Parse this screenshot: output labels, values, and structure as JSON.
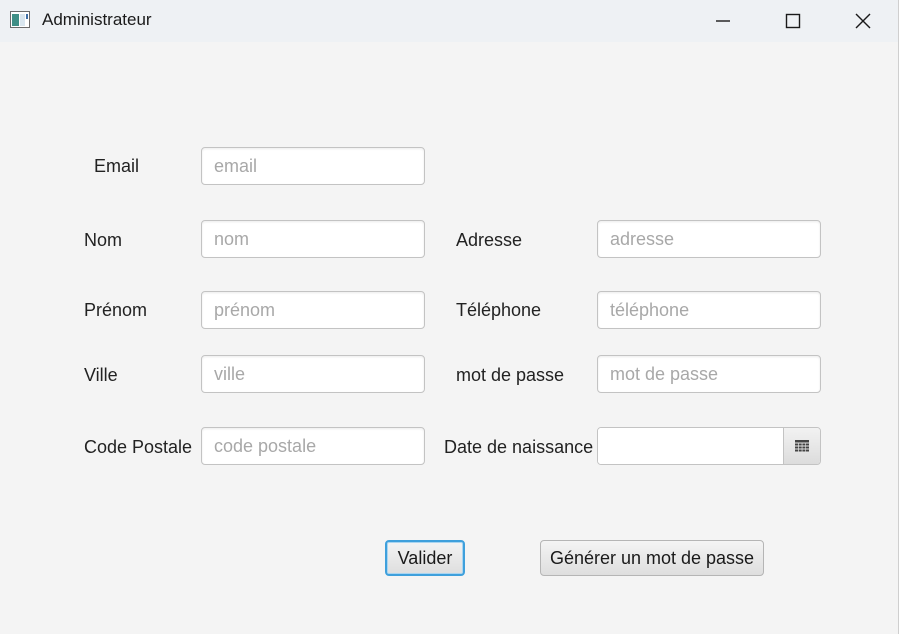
{
  "window": {
    "title": "Administrateur",
    "controls": {
      "minimize": "minimize-icon",
      "maximize": "maximize-icon",
      "close": "close-icon"
    }
  },
  "form": {
    "email": {
      "label": "Email",
      "placeholder": "email",
      "value": ""
    },
    "nom": {
      "label": "Nom",
      "placeholder": "nom",
      "value": ""
    },
    "adresse": {
      "label": "Adresse",
      "placeholder": "adresse",
      "value": ""
    },
    "prenom": {
      "label": "Prénom",
      "placeholder": "prénom",
      "value": ""
    },
    "telephone": {
      "label": "Téléphone",
      "placeholder": "téléphone",
      "value": ""
    },
    "ville": {
      "label": "Ville",
      "placeholder": "ville",
      "value": ""
    },
    "mot_de_passe": {
      "label": "mot de passe",
      "placeholder": "mot de passe",
      "value": ""
    },
    "code_postale": {
      "label": "Code Postale",
      "placeholder": "code postale",
      "value": ""
    },
    "date_naissance": {
      "label": "Date de naissance",
      "value": "",
      "icon": "calendar-icon"
    }
  },
  "buttons": {
    "valider": "Valider",
    "generer": "Générer un mot de passe"
  },
  "colors": {
    "focus_accent": "#3fa0dc",
    "titlebar": "#eef1f4",
    "background": "#f4f4f4"
  }
}
